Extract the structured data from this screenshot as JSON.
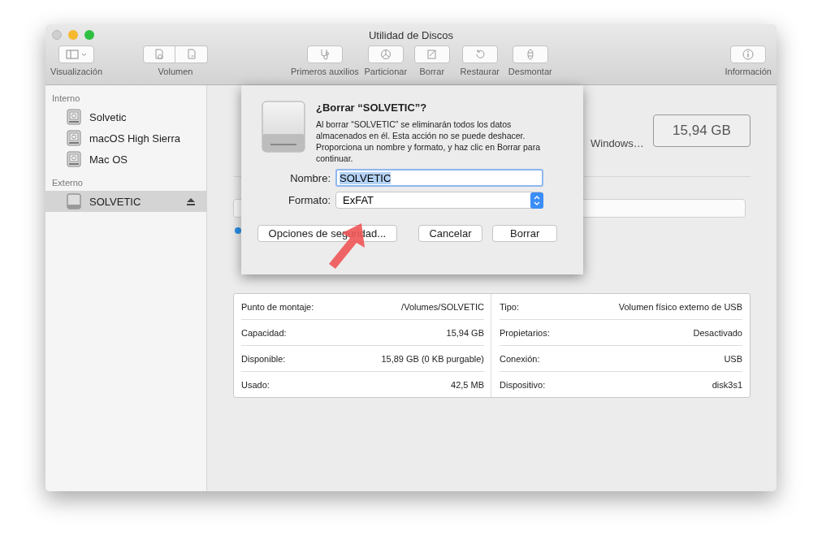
{
  "window": {
    "title": "Utilidad de Discos"
  },
  "toolbar": [
    {
      "label": "Visualización",
      "kind": "view"
    },
    {
      "label": "Volumen",
      "kind": "pair"
    },
    {
      "label": "Primeros auxilios",
      "kind": "aid"
    },
    {
      "label": "Particionar",
      "kind": "partition"
    },
    {
      "label": "Borrar",
      "kind": "erase"
    },
    {
      "label": "Restaurar",
      "kind": "restore"
    },
    {
      "label": "Desmontar",
      "kind": "unmount"
    },
    {
      "label": "Información",
      "kind": "info"
    }
  ],
  "sidebar": {
    "sections": [
      {
        "title": "Interno",
        "items": [
          {
            "name": "Solvetic",
            "selected": false,
            "kind": "internal"
          },
          {
            "name": "macOS High Sierra",
            "selected": false,
            "kind": "internal"
          },
          {
            "name": "Mac OS",
            "selected": false,
            "kind": "internal"
          }
        ]
      },
      {
        "title": "Externo",
        "items": [
          {
            "name": "SOLVETIC",
            "selected": true,
            "kind": "external"
          }
        ]
      }
    ]
  },
  "disk": {
    "description": "Windows…",
    "size": "15,94 GB"
  },
  "info": {
    "left": [
      {
        "label": "Punto de montaje:",
        "value": "/Volumes/SOLVETIC"
      },
      {
        "label": "Capacidad:",
        "value": "15,94 GB"
      },
      {
        "label": "Disponible:",
        "value": "15,89 GB (0 KB purgable)"
      },
      {
        "label": "Usado:",
        "value": "42,5 MB"
      }
    ],
    "right": [
      {
        "label": "Tipo:",
        "value": "Volumen físico externo de USB"
      },
      {
        "label": "Propietarios:",
        "value": "Desactivado"
      },
      {
        "label": "Conexión:",
        "value": "USB"
      },
      {
        "label": "Dispositivo:",
        "value": "disk3s1"
      }
    ]
  },
  "dialog": {
    "title": "¿Borrar “SOLVETIC”?",
    "message": "Al borrar “SOLVETIC” se eliminarán todos los datos almacenados en él. Esta acción no se puede deshacer. Proporciona un nombre y formato, y haz clic en Borrar para continuar.",
    "name_label": "Nombre:",
    "name_value": "SOLVETIC",
    "format_label": "Formato:",
    "format_value": "ExFAT",
    "buttons": [
      {
        "label": "Opciones de seguridad...",
        "kind": "secondary"
      },
      {
        "label": "Cancelar",
        "kind": "normal"
      },
      {
        "label": "Borrar",
        "kind": "normal"
      }
    ]
  }
}
